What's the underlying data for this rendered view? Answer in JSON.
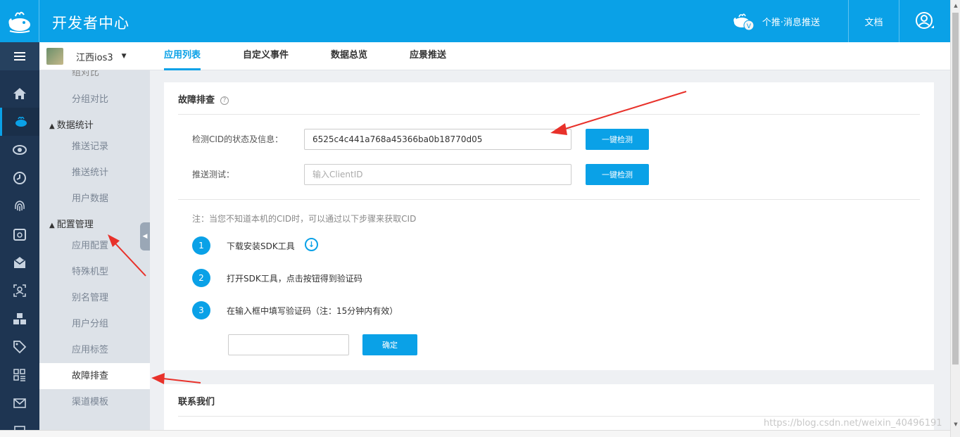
{
  "header": {
    "brand": "开发者中心",
    "push_label": "个推·消息推送",
    "docs_label": "文档",
    "logo_icon": "whale-logo-icon",
    "user_icon": "user-circle-icon",
    "accent_color": "#0aa1e7"
  },
  "rail": {
    "icons": [
      "menu-icon",
      "home-icon",
      "push-whale-icon",
      "eye-icon",
      "clock-icon",
      "fingerprint-icon",
      "calendar-icon",
      "mail-icon",
      "user-scan-icon",
      "cubes-icon",
      "tag-icon",
      "grid-icon",
      "envelope-icon",
      "doc-icon"
    ],
    "active_index": 1
  },
  "app_switch": {
    "name": "江西ios3",
    "caret": "▼"
  },
  "tabs": [
    {
      "label": "应用列表",
      "active": true
    },
    {
      "label": "自定义事件",
      "active": false
    },
    {
      "label": "数据总览",
      "active": false
    },
    {
      "label": "应景推送",
      "active": false
    }
  ],
  "sidebar": {
    "partial_top": "组对比",
    "items_top": [
      {
        "label": "分组对比"
      }
    ],
    "group_stats": {
      "label": "数据统计",
      "tri": "▲"
    },
    "stats_items": [
      {
        "label": "推送记录"
      },
      {
        "label": "推送统计"
      },
      {
        "label": "用户数据"
      }
    ],
    "group_config": {
      "label": "配置管理",
      "tri": "▲"
    },
    "config_items": [
      {
        "label": "应用配置"
      },
      {
        "label": "特殊机型"
      },
      {
        "label": "别名管理"
      },
      {
        "label": "用户分组"
      },
      {
        "label": "应用标签"
      },
      {
        "label": "故障排查",
        "active": true
      },
      {
        "label": "渠道模板"
      }
    ],
    "collapse_glyph": "◀"
  },
  "troubleshoot": {
    "title": "故障排查",
    "help_glyph": "?",
    "cid_label": "检测CID的状态及信息：",
    "cid_value": "6525c4c441a768a45366ba0b18770d05",
    "cid_button": "一键检测",
    "push_label": "推送测试：",
    "push_placeholder": "输入ClientID",
    "push_button": "一键检测",
    "note": "注：当您不知道本机的CID时，可以通过以下步骤来获取CID",
    "steps": [
      {
        "num": "1",
        "text": "下载安装SDK工具"
      },
      {
        "num": "2",
        "text": "打开SDK工具，点击按钮得到验证码"
      },
      {
        "num": "3",
        "text": "在输入框中填写验证码（注：15分钟内有效）"
      }
    ],
    "download_glyph": "↓",
    "confirm_button": "确定"
  },
  "contact": {
    "title": "联系我们"
  },
  "watermark": "https://blog.csdn.net/weixin_40496191",
  "scrollbar": {
    "up": "▲",
    "down": "▼"
  }
}
